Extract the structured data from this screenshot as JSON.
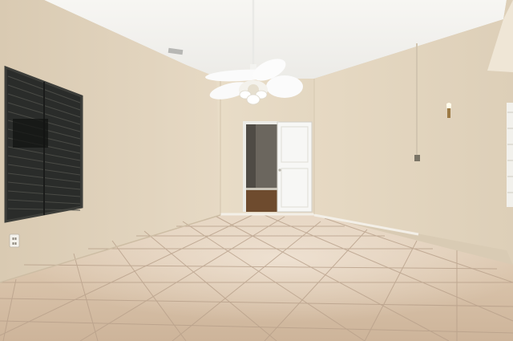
{
  "photo": {
    "subject": "empty room",
    "colors": {
      "ceiling": "#f3f2ee",
      "wall_left": "#e0d2bc",
      "wall_back": "#e8dcc6",
      "wall_right": "#e3d5bf",
      "floor_tile": "#d6bfa6",
      "grout": "#a8917a",
      "door": "#f7f7f5",
      "doorway_interior": "#5e5850",
      "window_blinds": "#232523",
      "fan_white": "#fbfbfb"
    }
  }
}
